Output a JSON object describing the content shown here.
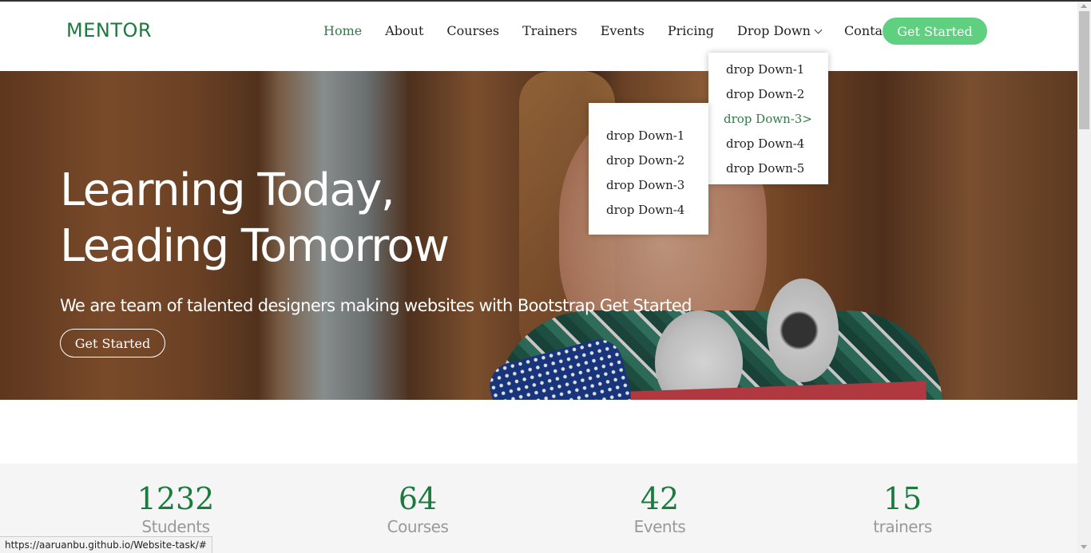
{
  "header": {
    "logo": "MENTOR",
    "nav": {
      "home": "Home",
      "about": "About",
      "courses": "Courses",
      "trainers": "Trainers",
      "events": "Events",
      "pricing": "Pricing",
      "dropdown": "Drop Down",
      "contact": "Contant"
    },
    "cta": "Get Started"
  },
  "dropdown_menu": {
    "items": [
      "drop Down-1",
      "drop Down-2",
      "drop Down-3>",
      "drop Down-4",
      "drop Down-5"
    ]
  },
  "submenu": {
    "items": [
      "drop Down-1",
      "drop Down-2",
      "drop Down-3",
      "drop Down-4"
    ]
  },
  "hero": {
    "title_line1": "Learning Today,",
    "title_line2": "Leading Tomorrow",
    "subtitle": "We are team of talented designers making websites with Bootstrap Get Started",
    "button": "Get Started"
  },
  "stats": [
    {
      "value": "1232",
      "label": "Students"
    },
    {
      "value": "64",
      "label": "Courses"
    },
    {
      "value": "42",
      "label": "Events"
    },
    {
      "value": "15",
      "label": "trainers"
    }
  ],
  "statusbar": {
    "url": "https://aaruanbu.github.io/Website-task/#"
  },
  "colors": {
    "brand_green": "#5fcf80",
    "accent_green": "#1b7a3d"
  }
}
